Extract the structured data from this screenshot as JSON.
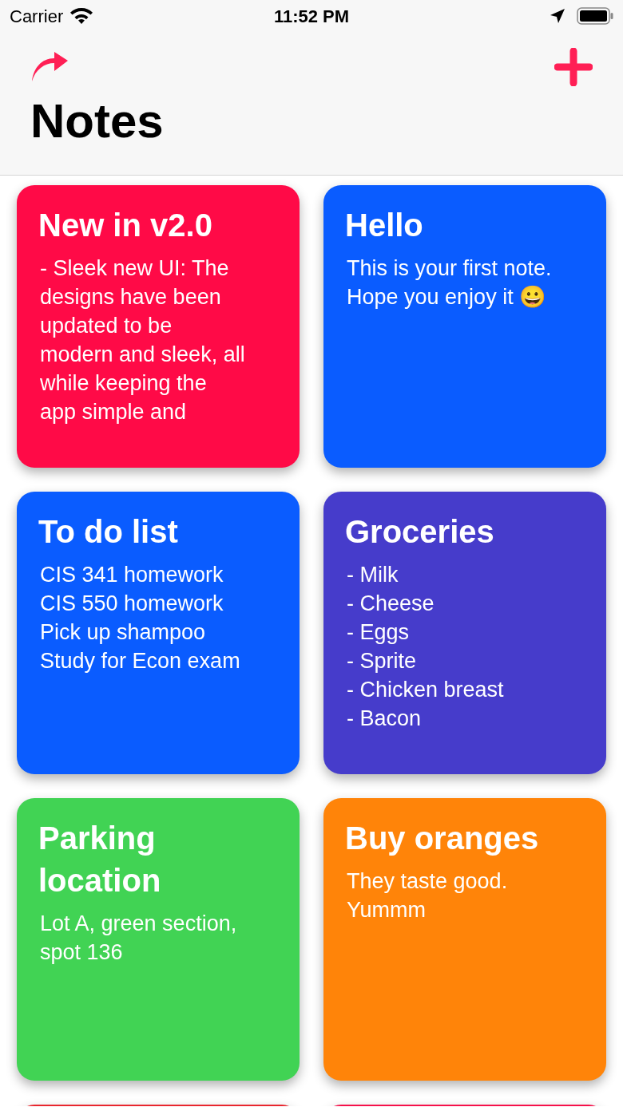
{
  "status_bar": {
    "carrier": "Carrier",
    "time": "11:52 PM"
  },
  "nav": {
    "title": "Notes"
  },
  "notes": [
    {
      "title": "New in v2.0",
      "lines": [
        "- Sleek new UI: The",
        "designs have been",
        "updated to be",
        "modern and sleek, all",
        "while keeping the",
        "app simple and"
      ],
      "color": "#ff0a47"
    },
    {
      "title": "Hello",
      "lines": [
        "This is your first note.",
        "Hope you enjoy it 😀"
      ],
      "color": "#0a5cff"
    },
    {
      "title": "To do list",
      "lines": [
        "CIS 341 homework",
        "CIS 550 homework",
        "Pick up shampoo",
        "Study for Econ exam"
      ],
      "color": "#0a5cff"
    },
    {
      "title": "Groceries",
      "lines": [
        "- Milk",
        "- Cheese",
        "- Eggs",
        "- Sprite",
        "- Chicken breast",
        "- Bacon"
      ],
      "color": "#463ccb"
    },
    {
      "title": "Parking location",
      "lines": [
        "Lot A, green section,",
        "spot 136"
      ],
      "color": "#41d354"
    },
    {
      "title": "Buy oranges",
      "lines": [
        "They taste good.",
        "Yummm"
      ],
      "color": "#ff8409"
    },
    {
      "color": "#e8262e"
    },
    {
      "color": "#f5104a"
    }
  ]
}
